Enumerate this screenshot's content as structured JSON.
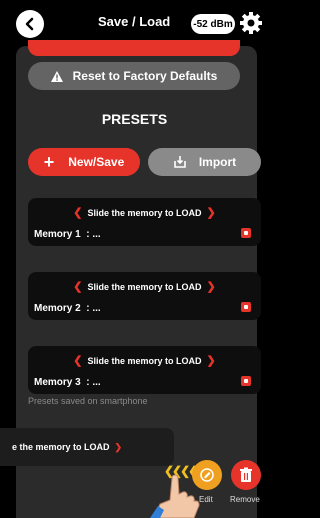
{
  "header": {
    "title": "Save / Load",
    "signal": "-52 dBm"
  },
  "actions": {
    "reset_label": "Reset to Factory Defaults"
  },
  "presets": {
    "title": "PRESETS",
    "new_save_label": "New/Save",
    "import_label": "Import",
    "slide_text": "Slide the memory to LOAD",
    "memories": [
      {
        "name": "Memory 1",
        "value": ": ..."
      },
      {
        "name": "Memory 2",
        "value": ": ..."
      },
      {
        "name": "Memory 3",
        "value": ": ..."
      }
    ]
  },
  "phone": {
    "label": "Presets saved on smartphone",
    "partial_slide_text": "e the memory to LOAD",
    "edit_label": "Edit",
    "remove_label": "Remove"
  },
  "colors": {
    "accent_red": "#e6342b",
    "edit_orange": "#f0a020",
    "panel": "#2b2b2b"
  }
}
